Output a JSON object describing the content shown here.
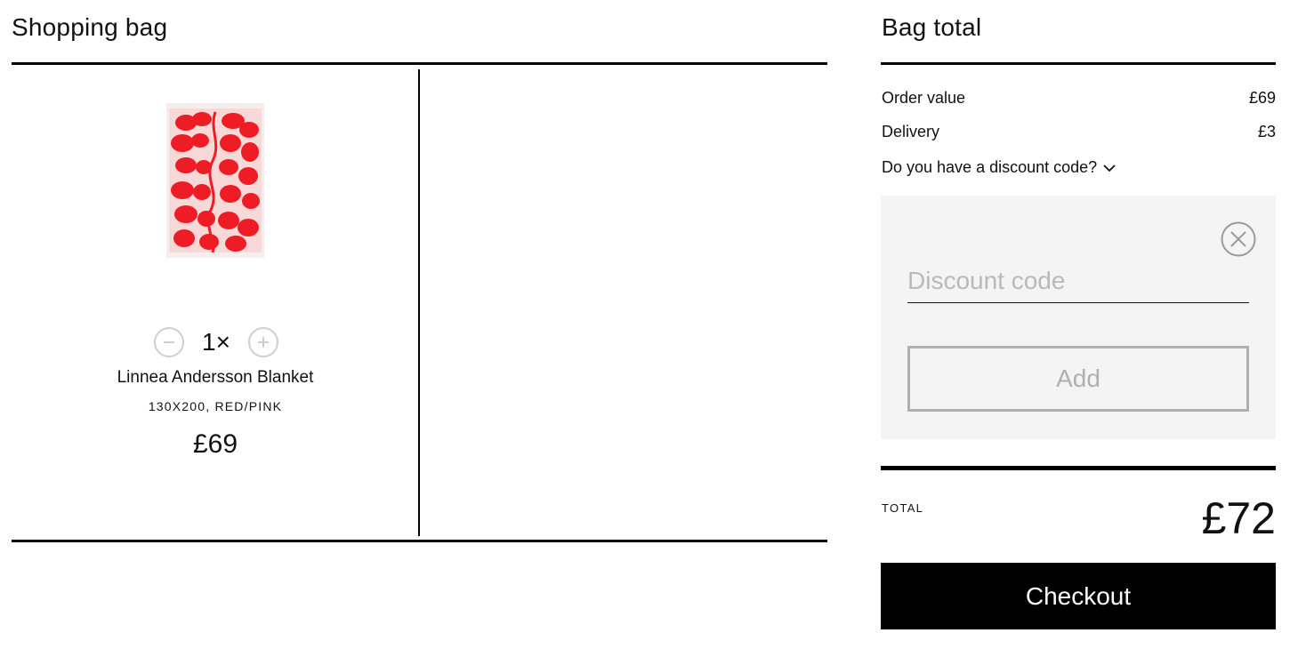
{
  "bag": {
    "title": "Shopping bag",
    "items": [
      {
        "quantity": "1×",
        "name": "Linnea Andersson Blanket",
        "variant": "130X200, RED/PINK",
        "price": "£69",
        "image": "red-leaf-blanket-image"
      }
    ]
  },
  "summary": {
    "title": "Bag total",
    "order_value_label": "Order value",
    "order_value": "£69",
    "delivery_label": "Delivery",
    "delivery": "£3",
    "discount_toggle": "Do you have a discount code?",
    "discount_placeholder": "Discount code",
    "add_label": "Add",
    "total_label": "TOTAL",
    "total": "£72",
    "checkout_label": "Checkout"
  },
  "colors": {
    "accent": "#ee1c25",
    "panel": "#f4f4f4",
    "muted": "#b9b9b9"
  }
}
